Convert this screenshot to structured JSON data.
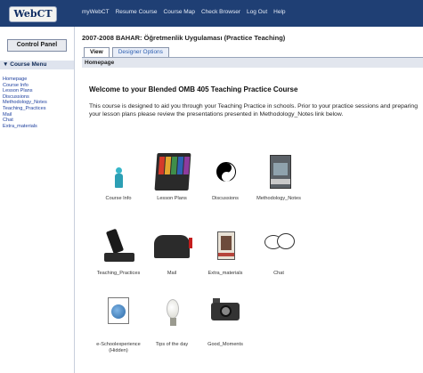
{
  "topbar": {
    "logo_text": "WebCT",
    "nav": [
      "myWebCT",
      "Resume Course",
      "Course Map",
      "Check Browser",
      "Log Out",
      "Help"
    ]
  },
  "sidebar": {
    "control_panel_label": "Control Panel",
    "menu_title": "Course Menu",
    "items": [
      "Homepage",
      "Course Info",
      "Lesson Plans",
      "Discussions",
      "Methodology_Notes",
      "Teaching_Practices",
      "Mail",
      "Chat",
      "Extra_materials"
    ]
  },
  "main": {
    "breadcrumb": "2007-2008 BAHAR: Öğretmenlik Uygulaması (Practice Teaching)",
    "tabs": [
      "View",
      "Designer Options"
    ],
    "page_label": "Homepage",
    "welcome": "Welcome to your Blended OMB 405 Teaching Practice Course",
    "intro": "This course is designed to aid you through your Teaching Practice in schools. Prior to your practice sessions and preparing your lesson plans please review the presentations presented in Methodology_Notes link below.",
    "tiles": [
      {
        "label": "Course Info",
        "icon": "course-info-icon"
      },
      {
        "label": "Lesson Plans",
        "icon": "lesson-plans-icon"
      },
      {
        "label": "Discussions",
        "icon": "discussions-icon"
      },
      {
        "label": "Methodology_Notes",
        "icon": "methodology-notes-icon"
      },
      {
        "label": "Teaching_Practices",
        "icon": "teaching-practices-icon"
      },
      {
        "label": "Mail",
        "icon": "mail-icon"
      },
      {
        "label": "Extra_materials",
        "icon": "extra-materials-icon"
      },
      {
        "label": "Chat",
        "icon": "chat-icon"
      },
      {
        "label": "e-Schoolexperience\n(Hidden)",
        "icon": "e-school-icon"
      },
      {
        "label": "Tips of the day",
        "icon": "tips-icon"
      },
      {
        "label": "Good_Moments",
        "icon": "good-moments-icon"
      }
    ]
  }
}
